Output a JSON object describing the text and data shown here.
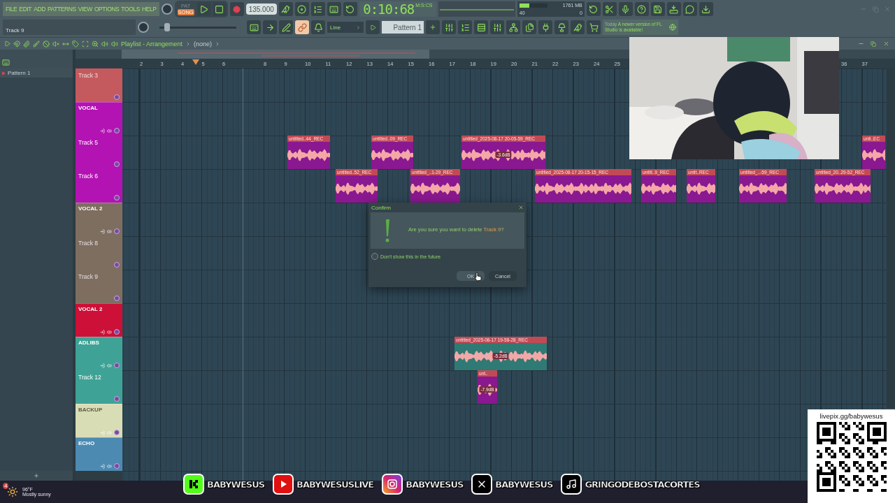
{
  "menu": [
    "FILE",
    "EDIT",
    "ADD",
    "PATTERNS",
    "VIEW",
    "OPTIONS",
    "TOOLS",
    "HELP"
  ],
  "transport": {
    "modes": [
      {
        "label": "PAT",
        "selected": false
      },
      {
        "label": "SONG",
        "selected": true
      }
    ],
    "tempo": "135.000",
    "time": "0:10:68",
    "time_unit": "M:S:CS"
  },
  "hint": "Track 9",
  "cpu": {
    "value": "40",
    "memory": "1761 MB",
    "voices": "0",
    "level": 0.35
  },
  "master_pitch": {
    "level": 0.06
  },
  "snap": "Line",
  "pattern": "Pattern 1",
  "news": {
    "when": "Today",
    "text": "A newer version of FL Studio is available!"
  },
  "playlist": {
    "title": "Playlist - Arrangement",
    "crumb": "(none)"
  },
  "patterns": [
    {
      "label": "Pattern 1",
      "selected": true
    }
  ],
  "ruler": [
    "2",
    "3",
    "4",
    "5",
    "6",
    "8",
    "9",
    "10",
    "11",
    "12",
    "13",
    "14",
    "15",
    "16",
    "17",
    "18",
    "19",
    "20",
    "21",
    "22",
    "23",
    "24",
    "25",
    "36",
    "37"
  ],
  "tracks": [
    {
      "kind": "track",
      "name": "Track 3",
      "color": "#c45a5e",
      "dimmed": true
    },
    {
      "kind": "group",
      "name": "VOCAL",
      "color": "#b313b3",
      "dimmed": false
    },
    {
      "kind": "track",
      "name": "Track 5",
      "color": "#b313b3",
      "dimmed": false
    },
    {
      "kind": "track",
      "name": "Track 6",
      "color": "#b313b3",
      "dimmed": false
    },
    {
      "kind": "group",
      "name": "VOCAL 2",
      "color": "#7e6e60",
      "dimmed": false
    },
    {
      "kind": "track",
      "name": "Track 8",
      "color": "#7e6e60",
      "dimmed": true
    },
    {
      "kind": "track",
      "name": "Track 9",
      "color": "#7e6e60",
      "dimmed": true
    },
    {
      "kind": "group",
      "name": "VOCAL 2",
      "color": "#cc1038",
      "dimmed": false
    },
    {
      "kind": "group",
      "name": "ADLIBS",
      "color": "#3ea396",
      "dimmed": false
    },
    {
      "kind": "track",
      "name": "Track 12",
      "color": "#3ea396",
      "dimmed": false
    },
    {
      "kind": "group",
      "name": "BACKUP",
      "color": "#d8ddb6",
      "dimmed": false
    },
    {
      "kind": "group",
      "name": "ECHO",
      "color": "#4c8ab2",
      "dimmed": false
    }
  ],
  "clips": [
    {
      "label": "untitled..44_REC"
    },
    {
      "label": "untitled..09_REC"
    },
    {
      "label": "untitled_2025-08-17 20-05-59_REC",
      "gain": "-3.6dB"
    },
    {
      "label": "unti..EC"
    },
    {
      "label": "untitled..52_REC"
    },
    {
      "label": "untitled_..1-29_REC"
    },
    {
      "label": "untitled_2025-08-17 20-15-15_REC"
    },
    {
      "label": "untitl..9_REC"
    },
    {
      "label": "untit..REC"
    },
    {
      "label": "untitled_..-59_REC"
    },
    {
      "label": "untitled_20..29-52_REC"
    },
    {
      "label": "untitled_2025-08-17 19-58-28_REC",
      "gain": "-5.2dB"
    },
    {
      "label": "unt..",
      "gain": "-7.9dB"
    }
  ],
  "dialog": {
    "title": "Confirm",
    "message": "Are you sure you want to delete ",
    "target": "Track 9",
    "end": "?",
    "option": {
      "label": "Don't show this in the future",
      "checked": false
    },
    "buttons": [
      {
        "label": "OK",
        "focused": true
      },
      {
        "label": "Cancel",
        "focused": false
      }
    ]
  },
  "qr": {
    "url": "livepix.gg/babywesus"
  },
  "socials": [
    {
      "kind": "kick",
      "handle": "BABYWESUS"
    },
    {
      "kind": "youtube",
      "handle": "BABYWESUSLIVE"
    },
    {
      "kind": "instagram",
      "handle": "BABYWESUS"
    },
    {
      "kind": "x",
      "handle": "BABYWESUS"
    },
    {
      "kind": "tiktok",
      "handle": "GRINGODEBOSTACORTES"
    }
  ],
  "weather": {
    "badge": "4",
    "temperature": "96°F",
    "condition": "Mostly sunny"
  }
}
